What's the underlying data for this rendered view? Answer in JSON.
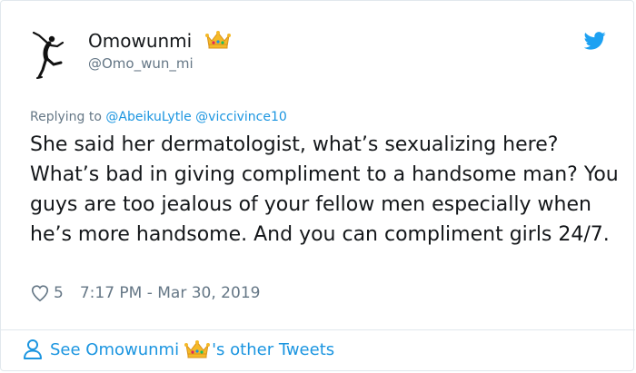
{
  "author": {
    "name": "Omowunmi",
    "handle": "@Omo_wun_mi",
    "avatar_icon": "dancer-silhouette-icon",
    "badge_icon": "crown-emoji-icon"
  },
  "reply": {
    "prefix": "Replying to",
    "mentions": [
      "@AbeikuLytle",
      "@viccivince10"
    ]
  },
  "tweet": {
    "text": "She said her dermatologist, what’s sexualizing here? What’s bad in giving compliment to a handsome man? You guys are too jealous of your fellow men especially when he’s more handsome. And you can compliment girls 24/7."
  },
  "meta": {
    "likes": "5",
    "timestamp": "7:17 PM - Mar 30, 2019"
  },
  "footer": {
    "prefix": "See Omowunmi",
    "suffix": "'s other Tweets"
  },
  "colors": {
    "link": "#1b95e0",
    "muted": "#657786",
    "text": "#14171a",
    "border": "#e1e8ed"
  }
}
